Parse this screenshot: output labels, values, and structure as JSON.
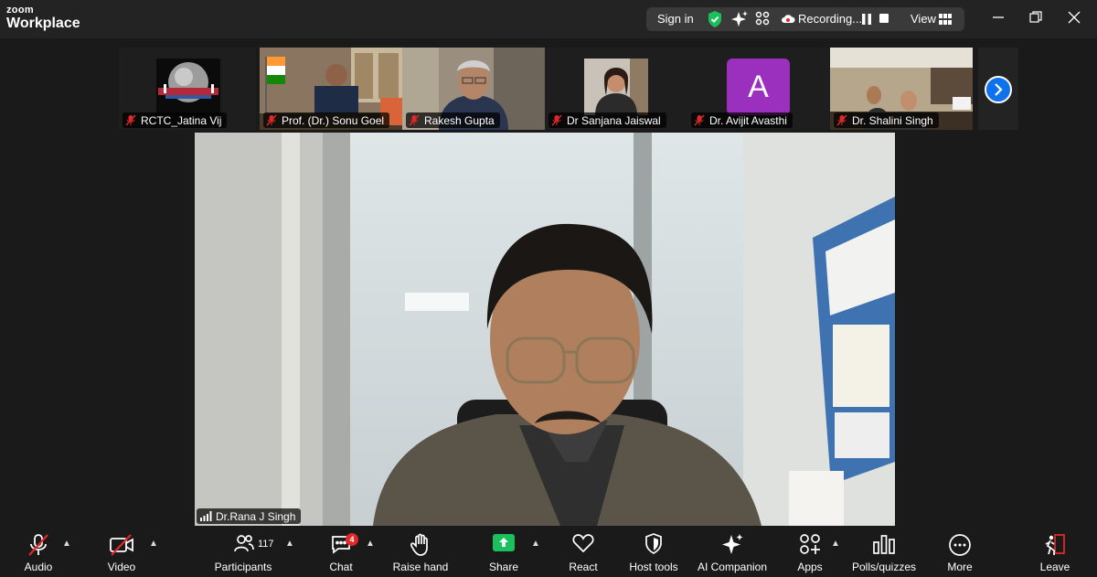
{
  "app": {
    "brand_top": "zoom",
    "brand_bottom": "Workplace"
  },
  "topbar": {
    "sign_in": "Sign in",
    "recording_label": "Recording...",
    "view_label": "View"
  },
  "participants_strip": [
    {
      "name": "RCTC_Jatina Vij",
      "muted": true
    },
    {
      "name": "Prof. (Dr.) Sonu Goel",
      "muted": true
    },
    {
      "name": "Rakesh Gupta",
      "muted": true
    },
    {
      "name": "Dr Sanjana Jaiswal",
      "muted": true
    },
    {
      "name": "Dr. Avijit Avasthi",
      "muted": true,
      "avatar_letter": "A"
    },
    {
      "name": "Dr. Shalini Singh",
      "muted": true
    }
  ],
  "active_speaker": {
    "name": "Dr.Rana J Singh"
  },
  "toolbar": {
    "audio": "Audio",
    "video": "Video",
    "participants": "Participants",
    "participants_count": "117",
    "chat": "Chat",
    "chat_badge": "4",
    "raise_hand": "Raise hand",
    "share": "Share",
    "react": "React",
    "host_tools": "Host tools",
    "ai_companion": "AI Companion",
    "apps": "Apps",
    "polls": "Polls/quizzes",
    "more": "More",
    "leave": "Leave"
  },
  "colors": {
    "accent": "#0e72ed",
    "share_green": "#19c05b",
    "mute_red": "#e02828",
    "avatar_purple": "#9b2fbe"
  }
}
